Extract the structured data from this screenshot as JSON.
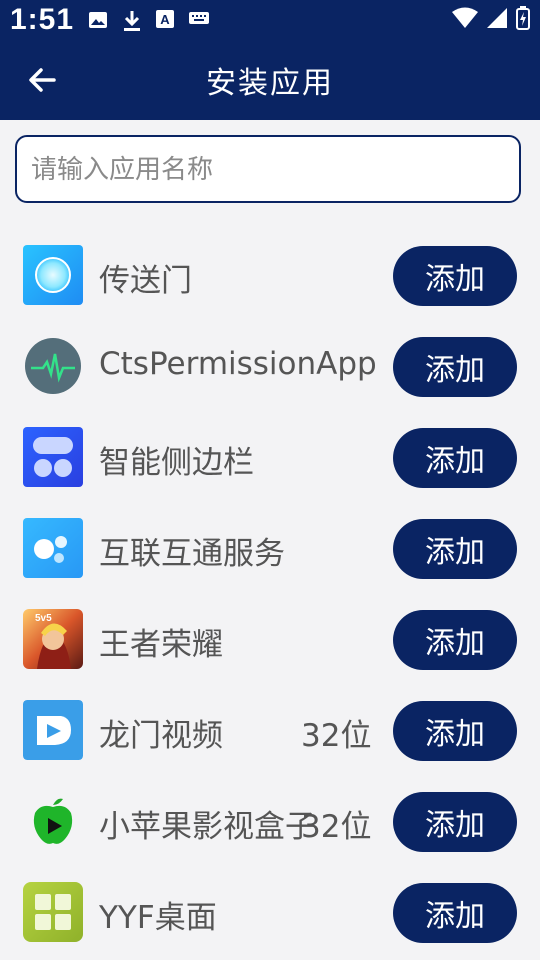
{
  "status_bar": {
    "time": "1:51",
    "icons_left": [
      "image-icon",
      "download-icon",
      "font-icon",
      "keyboard-icon"
    ],
    "icons_right": [
      "wifi-icon",
      "signal-icon",
      "battery-icon"
    ]
  },
  "header": {
    "title": "安装应用",
    "back_icon": "arrow-left-icon"
  },
  "search": {
    "placeholder": "请输入应用名称",
    "value": ""
  },
  "colors": {
    "primary": "#0a2463",
    "background": "#f3f3f5",
    "text": "#555555"
  },
  "apps": [
    {
      "name": "传送门",
      "bits": "",
      "button": "添加",
      "icon": "portal-icon"
    },
    {
      "name": "CtsPermissionApp",
      "bits": "",
      "button": "添加",
      "icon": "heartbeat-icon"
    },
    {
      "name": "智能侧边栏",
      "bits": "",
      "button": "添加",
      "icon": "sidebar-icon"
    },
    {
      "name": "互联互通服务",
      "bits": "",
      "button": "添加",
      "icon": "dots-icon"
    },
    {
      "name": "王者荣耀",
      "bits": "",
      "button": "添加",
      "icon": "game-icon"
    },
    {
      "name": "龙门视频",
      "bits": "32位",
      "button": "添加",
      "icon": "video-icon"
    },
    {
      "name": "小苹果影视盒子",
      "bits": "32位",
      "button": "添加",
      "icon": "apple-icon"
    },
    {
      "name": "YYF桌面",
      "bits": "",
      "button": "添加",
      "icon": "launcher-icon"
    }
  ]
}
